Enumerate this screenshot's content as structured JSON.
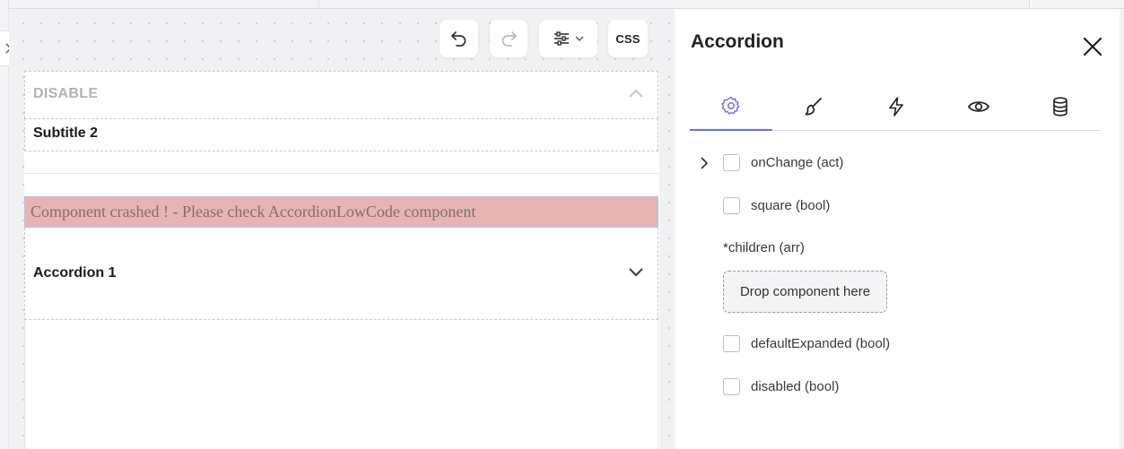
{
  "toolbar": {
    "css_label": "CSS"
  },
  "canvas": {
    "accordion_header": "DISABLE",
    "subtitle": "Subtitle 2",
    "crash_message": "Component crashed ! - Please check AccordionLowCode component",
    "accordion_1": "Accordion 1"
  },
  "panel": {
    "title": "Accordion",
    "tabs": [
      "settings",
      "style",
      "events",
      "visibility",
      "data"
    ],
    "props": {
      "on_change": "onChange (act)",
      "square": "square (bool)",
      "children": "*children (arr)",
      "drop_zone": "Drop component here",
      "default_expanded": "defaultExpanded (bool)",
      "disabled": "disabled (bool)"
    }
  },
  "colors": {
    "accent": "#6e6fd6",
    "crash_bg": "#e8b3b3"
  }
}
